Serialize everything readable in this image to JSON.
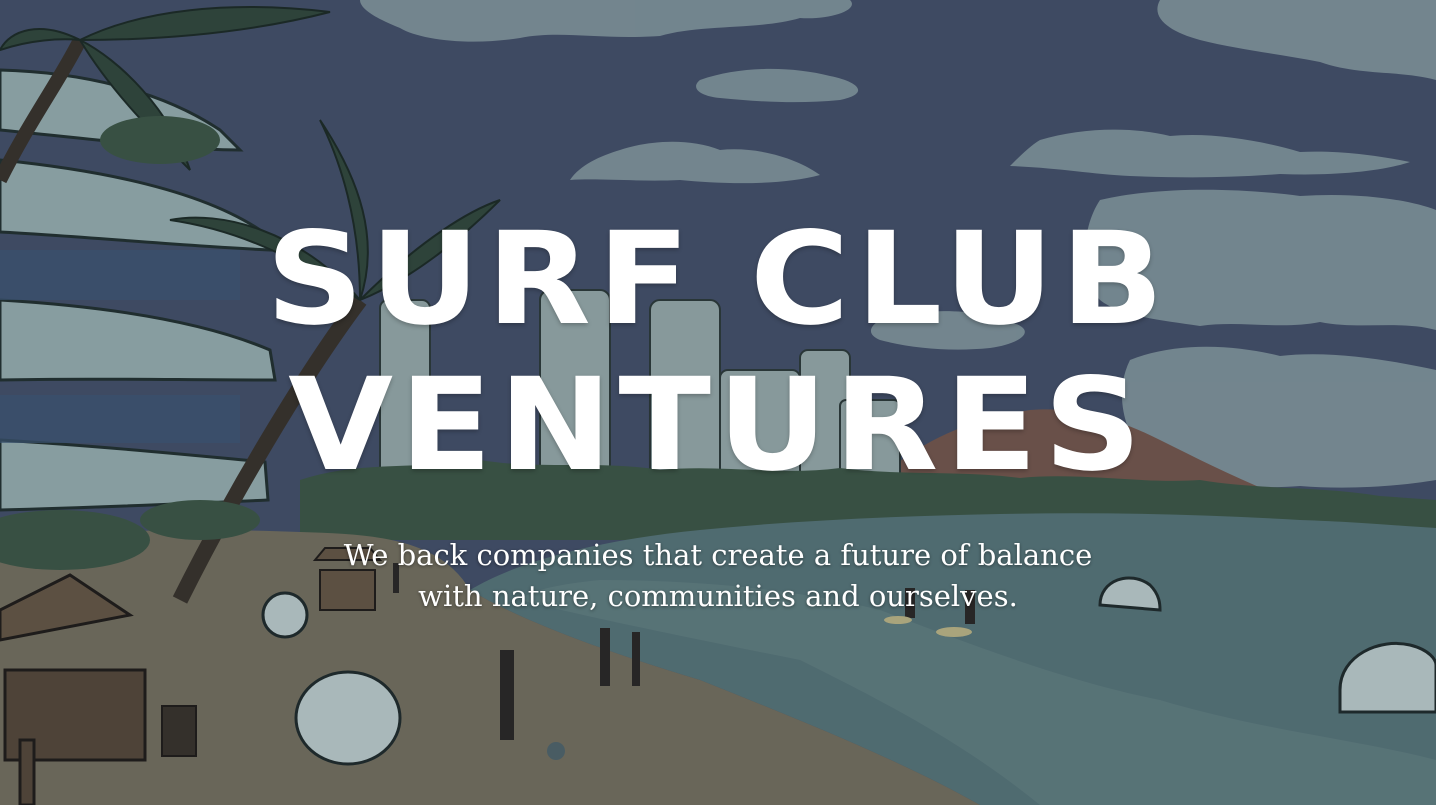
{
  "hero": {
    "title_line1": "SURF CLUB",
    "title_line2": "VENTURES",
    "tagline_line1": "We back companies that create a future of balance",
    "tagline_line2": "with nature, communities and ourselves."
  },
  "colors": {
    "sky": "#46526b",
    "cloud": "#8ea2a6",
    "sea": "#5b7a7c",
    "sand": "#7b7560",
    "foliage": "#3f5a45",
    "text": "#ffffff"
  }
}
